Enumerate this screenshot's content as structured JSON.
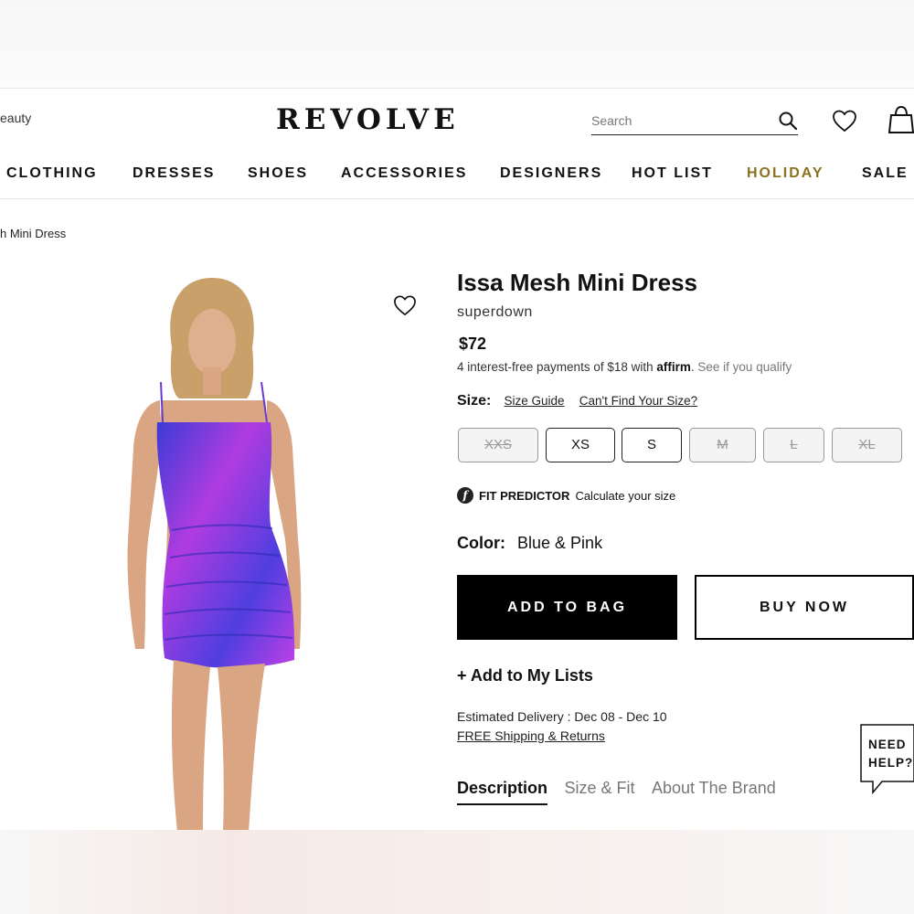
{
  "header": {
    "beauty_link": "eauty",
    "logo": "REVOLVE",
    "search_placeholder": "Search",
    "icons": {
      "search": "search-icon",
      "wishlist": "heart-icon",
      "bag": "shopping-bag-icon"
    }
  },
  "nav": {
    "items": [
      {
        "label": "CLOTHING"
      },
      {
        "label": "DRESSES"
      },
      {
        "label": "SHOES"
      },
      {
        "label": "ACCESSORIES"
      },
      {
        "label": "DESIGNERS"
      },
      {
        "label": "HOT LIST"
      },
      {
        "label": "HOLIDAY"
      },
      {
        "label": "SALE"
      }
    ],
    "holiday_color": "#8a7320"
  },
  "breadcrumb": "h Mini Dress",
  "product": {
    "title": "Issa Mesh Mini Dress",
    "brand": "superdown",
    "price": "$72",
    "affirm": {
      "text": "4 interest-free payments of $18 with",
      "logo": "affirm",
      "qualify": "See if you qualify"
    },
    "size_label": "Size:",
    "size_guide": "Size Guide",
    "cant_find": "Can't Find Your Size?",
    "sizes": [
      {
        "label": "XXS",
        "available": false
      },
      {
        "label": "XS",
        "available": true
      },
      {
        "label": "S",
        "available": true
      },
      {
        "label": "M",
        "available": false
      },
      {
        "label": "L",
        "available": false
      },
      {
        "label": "XL",
        "available": false
      }
    ],
    "fit_predictor": {
      "icon": "f",
      "title": "FIT PREDICTOR",
      "text": "Calculate your size"
    },
    "color_label": "Color:",
    "color_value": "Blue & Pink",
    "add_to_bag": "ADD TO BAG",
    "buy_now": "BUY NOW",
    "add_to_lists": "+ Add to My Lists",
    "delivery": "Estimated Delivery : Dec 08 - Dec 10",
    "shipping": "FREE Shipping & Returns",
    "tabs": [
      {
        "label": "Description",
        "active": true
      },
      {
        "label": "Size & Fit",
        "active": false
      },
      {
        "label": "About The Brand",
        "active": false
      }
    ],
    "dress_colors": {
      "primary": "#b03ce0",
      "secondary": "#3b3bd6"
    }
  },
  "help": {
    "line1": "NEED",
    "line2": "HELP?"
  }
}
